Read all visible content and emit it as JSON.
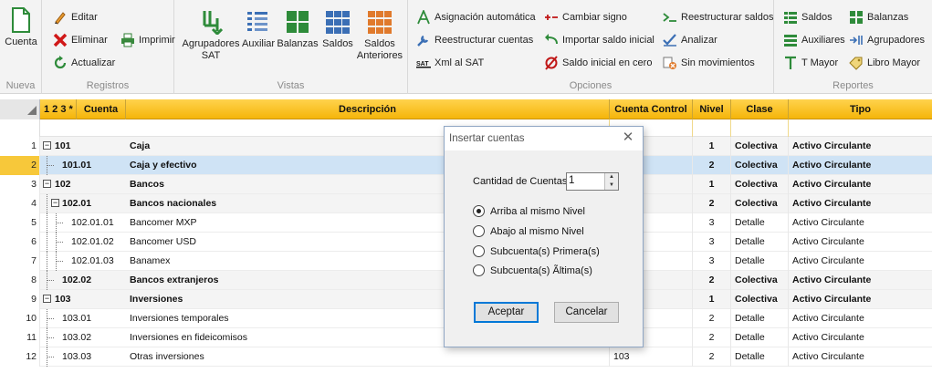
{
  "ribbon": {
    "nueva": {
      "group": "Nueva",
      "cuenta": "Cuenta"
    },
    "registros": {
      "group": "Registros",
      "editar": "Editar",
      "eliminar": "Eliminar",
      "imprimir": "Imprimir",
      "actualizar": "Actualizar"
    },
    "vistas": {
      "group": "Vistas",
      "agrupadores_sat": "Agrupadores SAT",
      "auxiliar": "Auxiliar",
      "balanzas": "Balanzas",
      "saldos": "Saldos",
      "saldos_anteriores": "Saldos Anteriores"
    },
    "opciones": {
      "group": "Opciones",
      "asignacion": "Asignación automática",
      "reestructurar_cuentas": "Reestructurar cuentas",
      "xml_sat": "Xml al SAT",
      "cambiar_signo": "Cambiar signo",
      "importar_saldo": "Importar saldo inicial",
      "saldo_cero": "Saldo inicial en cero",
      "reestructurar_saldos": "Reestructurar saldos",
      "analizar": "Analizar",
      "sin_movimientos": "Sin movimientos"
    },
    "reportes": {
      "group": "Reportes",
      "saldos": "Saldos",
      "balanzas": "Balanzas",
      "auxiliares": "Auxiliares",
      "agrupadores": "Agrupadores",
      "t_mayor": "T Mayor",
      "libro_mayor": "Libro Mayor"
    }
  },
  "grid": {
    "levels": "1 2 3 *",
    "columns": {
      "cuenta": "Cuenta",
      "descripcion": "Descripción",
      "control": "Cuenta Control",
      "nivel": "Nivel",
      "clase": "Clase",
      "tipo": "Tipo"
    },
    "rows": [
      {
        "n": "1",
        "cuenta": "101",
        "desc": "Caja",
        "control": "",
        "nivel": "1",
        "clase": "Colectiva",
        "tipo": "Activo Circulante"
      },
      {
        "n": "2",
        "cuenta": "101.01",
        "desc": "Caja y efectivo",
        "control": "",
        "nivel": "2",
        "clase": "Colectiva",
        "tipo": "Activo Circulante"
      },
      {
        "n": "3",
        "cuenta": "102",
        "desc": "Bancos",
        "control": "",
        "nivel": "1",
        "clase": "Colectiva",
        "tipo": "Activo Circulante"
      },
      {
        "n": "4",
        "cuenta": "102.01",
        "desc": "Bancos nacionales",
        "control": "",
        "nivel": "2",
        "clase": "Colectiva",
        "tipo": "Activo Circulante"
      },
      {
        "n": "5",
        "cuenta": "102.01.01",
        "desc": "Bancomer MXP",
        "control": "",
        "nivel": "3",
        "clase": "Detalle",
        "tipo": "Activo Circulante"
      },
      {
        "n": "6",
        "cuenta": "102.01.02",
        "desc": "Bancomer USD",
        "control": "",
        "nivel": "3",
        "clase": "Detalle",
        "tipo": "Activo Circulante"
      },
      {
        "n": "7",
        "cuenta": "102.01.03",
        "desc": "Banamex",
        "control": "",
        "nivel": "3",
        "clase": "Detalle",
        "tipo": "Activo Circulante"
      },
      {
        "n": "8",
        "cuenta": "102.02",
        "desc": "Bancos extranjeros",
        "control": "",
        "nivel": "2",
        "clase": "Colectiva",
        "tipo": "Activo Circulante"
      },
      {
        "n": "9",
        "cuenta": "103",
        "desc": "Inversiones",
        "control": "",
        "nivel": "1",
        "clase": "Colectiva",
        "tipo": "Activo Circulante"
      },
      {
        "n": "10",
        "cuenta": "103.01",
        "desc": "Inversiones temporales",
        "control": "",
        "nivel": "2",
        "clase": "Detalle",
        "tipo": "Activo Circulante"
      },
      {
        "n": "11",
        "cuenta": "103.02",
        "desc": "Inversiones en fideicomisos",
        "control": "",
        "nivel": "2",
        "clase": "Detalle",
        "tipo": "Activo Circulante"
      },
      {
        "n": "12",
        "cuenta": "103.03",
        "desc": "Otras inversiones",
        "control": "103",
        "nivel": "2",
        "clase": "Detalle",
        "tipo": "Activo Circulante"
      }
    ]
  },
  "dialog": {
    "title": "Insertar cuentas",
    "qty_label": "Cantidad de Cuentas",
    "qty_value": "1",
    "options": [
      "Arriba al mismo Nivel",
      "Abajo al mismo Nivel",
      "Subcuenta(s) Primera(s)",
      "Subcuenta(s) Ãltima(s)"
    ],
    "selected_option": "Arriba al mismo Nivel",
    "accept": "Aceptar",
    "cancel": "Cancelar"
  },
  "colors": {
    "header": "#f5b50a",
    "selected_row": "#cfe3f5",
    "selected_num": "#f7c83a"
  }
}
